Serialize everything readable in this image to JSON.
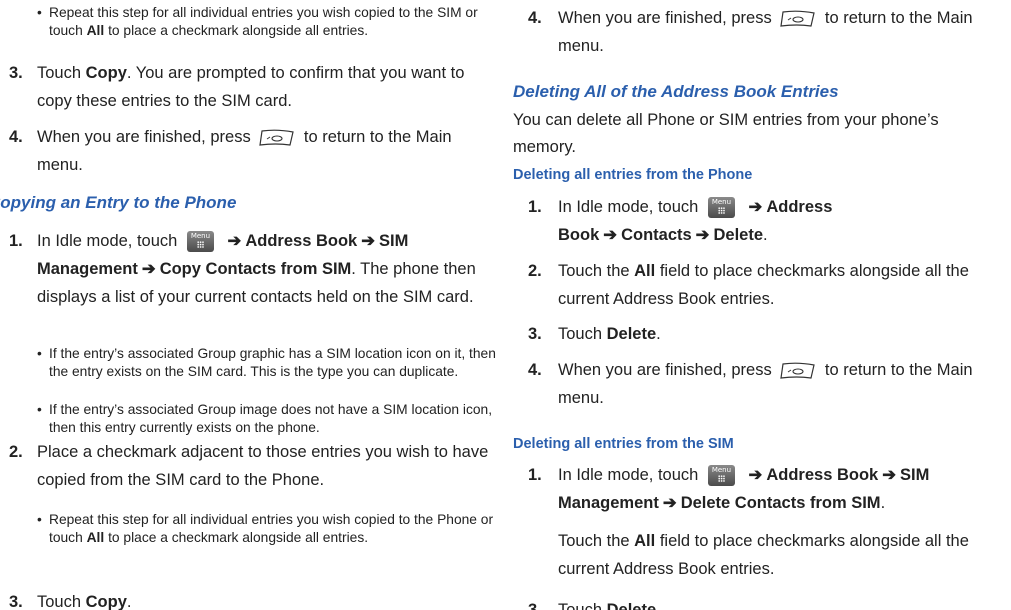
{
  "left": {
    "b_top": {
      "text_pre": "Repeat this step for all individual entries you wish copied to the SIM or touch ",
      "all": "All",
      "text_post": " to place a checkmark alongside all entries."
    },
    "s3": {
      "num": "3.",
      "pre": "Touch ",
      "bold": "Copy",
      "post": ". You are prompted to confirm that you want to copy these entries to the SIM card."
    },
    "s4": {
      "num": "4.",
      "pre": "When you are finished, press",
      "post": "to return to the Main menu."
    },
    "heading": "Copying an Entry to the Phone",
    "c1": {
      "num": "1.",
      "pre": "In Idle mode, touch",
      "p1": "Address Book",
      "p2": "SIM Management",
      "p3": "Copy Contacts from SIM",
      "post": ". The phone then displays a list of your current contacts held on the SIM card."
    },
    "b1": "If the entry’s associated Group graphic has a SIM location icon on it, then the entry exists on the SIM card. This is the type you can duplicate.",
    "b2": "If the entry’s associated Group image does not have a SIM location icon, then this entry currently exists on the phone.",
    "c2": {
      "num": "2.",
      "text": "Place a checkmark adjacent to those entries you wish to have copied from the SIM card to the Phone."
    },
    "b3": {
      "text_pre": "Repeat this step for all individual entries you wish copied to the Phone or touch ",
      "all": "All",
      "text_post": " to place a checkmark alongside all entries."
    },
    "c3": {
      "num": "3.",
      "pre": "Touch ",
      "bold": "Copy",
      "post": "."
    }
  },
  "right": {
    "s4": {
      "num": "4.",
      "pre": "When you are finished, press",
      "post": "to return to the Main menu."
    },
    "heading": "Deleting All of the Address Book Entries",
    "intro": "You can delete all Phone or SIM entries from your phone’s memory.",
    "sub1": "Deleting all entries from the Phone",
    "p1": {
      "num": "1.",
      "pre": "In Idle mode, touch",
      "p1": "Address Book",
      "p2": "Contacts",
      "p3": "Delete",
      "post": "."
    },
    "p2": {
      "num": "2.",
      "pre": "Touch the ",
      "bold": "All",
      "post": " field to place checkmarks alongside all the current Address Book entries."
    },
    "p3": {
      "num": "3.",
      "pre": "Touch ",
      "bold": "Delete",
      "post": "."
    },
    "p4": {
      "num": "4.",
      "pre": "When you are finished, press",
      "post": "to return to the Main menu."
    },
    "sub2": "Deleting all entries from the SIM",
    "q1": {
      "num": "1.",
      "pre": "In Idle mode, touch",
      "p1": "Address Book",
      "p2": "SIM Management",
      "p3": "Delete Contacts from SIM",
      "post": "."
    },
    "q2": {
      "pre": "Touch the ",
      "bold": "All",
      "post": " field to place checkmarks alongside all the current Address Book entries."
    },
    "q3": {
      "num": "3.",
      "pre": "Touch ",
      "bold": "Delete"
    }
  },
  "icons": {
    "menu_key_label": "Menu",
    "arrow": "➔",
    "bullet": "•"
  }
}
